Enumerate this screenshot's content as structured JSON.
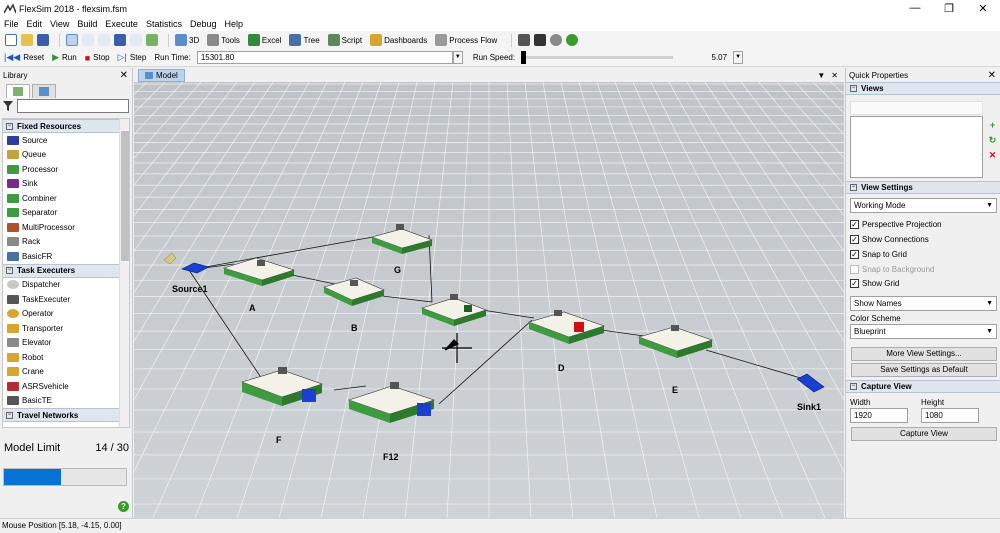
{
  "window": {
    "title": "FlexSim 2018 - flexsim.fsm",
    "buttons": [
      "—",
      "❐",
      "✕"
    ]
  },
  "menu": [
    "File",
    "Edit",
    "View",
    "Build",
    "Execute",
    "Statistics",
    "Debug",
    "Help"
  ],
  "toolbar": {
    "items": [
      {
        "label": "3D",
        "icon": "3d-icon"
      },
      {
        "label": "Tools",
        "icon": "tools-icon"
      },
      {
        "label": "Excel",
        "icon": "excel-icon"
      },
      {
        "label": "Tree",
        "icon": "tree-icon"
      },
      {
        "label": "Script",
        "icon": "script-icon"
      },
      {
        "label": "Dashboards",
        "icon": "dashboards-icon"
      },
      {
        "label": "Process Flow",
        "icon": "process-flow-icon"
      }
    ]
  },
  "run_controls": {
    "reset": "Reset",
    "run": "Run",
    "stop": "Stop",
    "step": "Step",
    "run_time_label": "Run Time:",
    "run_time_value": "15301.80",
    "run_speed_label": "Run Speed:",
    "run_speed_value": "5.07"
  },
  "library": {
    "title": "Library",
    "groups": [
      {
        "name": "Fixed Resources",
        "items": [
          "Source",
          "Queue",
          "Processor",
          "Sink",
          "Combiner",
          "Separator",
          "MultiProcessor",
          "Rack",
          "BasicFR"
        ]
      },
      {
        "name": "Task Executers",
        "items": [
          "Dispatcher",
          "TaskExecuter",
          "Operator",
          "Transporter",
          "Elevator",
          "Robot",
          "Crane",
          "ASRSvehicle",
          "BasicTE"
        ]
      },
      {
        "name": "Travel Networks",
        "items": []
      }
    ],
    "model_limit_label": "Model Limit",
    "model_limit_value": "14 / 30",
    "model_limit_fraction": 0.4667
  },
  "model_view": {
    "tab": "Model",
    "objects": [
      "Source1",
      "A",
      "B",
      "G",
      "D",
      "E",
      "F",
      "F12",
      "Sink1"
    ]
  },
  "quick_properties": {
    "title": "Quick Properties",
    "views_section": "Views",
    "view_settings_section": "View Settings",
    "working_mode": "Working Mode",
    "checks": [
      {
        "label": "Perspective Projection",
        "checked": true,
        "enabled": true
      },
      {
        "label": "Show Connections",
        "checked": true,
        "enabled": true
      },
      {
        "label": "Snap to Grid",
        "checked": true,
        "enabled": true
      },
      {
        "label": "Snap to Background",
        "checked": false,
        "enabled": false
      },
      {
        "label": "Show Grid",
        "checked": true,
        "enabled": true
      }
    ],
    "show_names": "Show Names",
    "color_scheme_label": "Color Scheme",
    "color_scheme": "Blueprint",
    "more_view_settings": "More View Settings...",
    "save_settings_default": "Save Settings as Default",
    "capture_view_section": "Capture View",
    "width_label": "Width",
    "height_label": "Height",
    "width_value": "1920",
    "height_value": "1080",
    "capture_view_button": "Capture View"
  },
  "status": {
    "mouse_position": "Mouse Position [5.18, -4.15, 0.00]"
  },
  "colors": {
    "accent": "#0673d4",
    "processor_green": "#3f9b3f",
    "box_blue": "#1b3fcf",
    "box_red": "#d01010"
  }
}
